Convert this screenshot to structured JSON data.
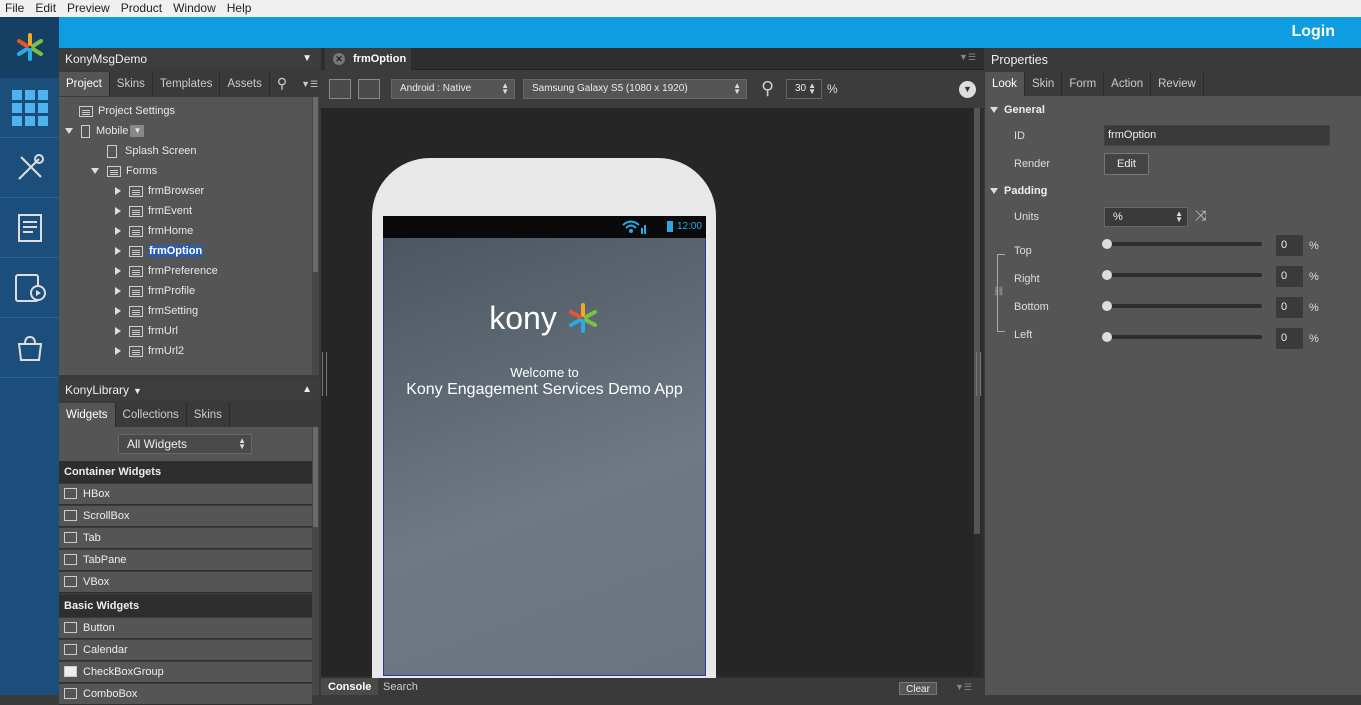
{
  "menu": [
    "File",
    "Edit",
    "Preview",
    "Product",
    "Window",
    "Help"
  ],
  "topbar": {
    "login_label": "Login"
  },
  "rail_icons": [
    "kony-logo-icon",
    "apps-grid-icon",
    "tools-icon",
    "notes-icon",
    "preview-icon",
    "store-bag-icon"
  ],
  "project": {
    "title": "KonyMsgDemo",
    "tabs": [
      "Project",
      "Skins",
      "Templates",
      "Assets"
    ],
    "tree": {
      "project_settings": "Project Settings",
      "mobile": "Mobile",
      "splash": "Splash Screen",
      "forms_label": "Forms",
      "forms": [
        "frmBrowser",
        "frmEvent",
        "frmHome",
        "frmOption",
        "frmPreference",
        "frmProfile",
        "frmSetting",
        "frmUrl",
        "frmUrl2"
      ],
      "selected": "frmOption"
    }
  },
  "library": {
    "title": "KonyLibrary",
    "tabs": [
      "Widgets",
      "Collections",
      "Skins"
    ],
    "filter": "All Widgets",
    "sections": {
      "container": "Container Widgets",
      "container_items": [
        "HBox",
        "ScrollBox",
        "Tab",
        "TabPane",
        "VBox"
      ],
      "basic": "Basic Widgets",
      "basic_items": [
        "Button",
        "Calendar",
        "CheckBoxGroup",
        "ComboBox"
      ]
    }
  },
  "editor": {
    "tab": "frmOption",
    "platform": "Android : Native",
    "device": "Samsung Galaxy S5 (1080 x 1920)",
    "zoom": "30",
    "zoom_unit": "%"
  },
  "preview": {
    "time": "12:00",
    "brand": "kony",
    "welcome": "Welcome to",
    "app_name": "Kony Engagement Services Demo App"
  },
  "bottom": {
    "tabs": [
      "Console",
      "Search"
    ],
    "clear_label": "Clear"
  },
  "properties": {
    "title": "Properties",
    "tabs": [
      "Look",
      "Skin",
      "Form",
      "Action",
      "Review"
    ],
    "general": "General",
    "id_label": "ID",
    "id_value": "frmOption",
    "render_label": "Render",
    "edit_label": "Edit",
    "padding": "Padding",
    "units_label": "Units",
    "units_value": "%",
    "sides": [
      {
        "label": "Top",
        "value": "0"
      },
      {
        "label": "Right",
        "value": "0"
      },
      {
        "label": "Bottom",
        "value": "0"
      },
      {
        "label": "Left",
        "value": "0"
      }
    ],
    "pct": "%"
  },
  "colors": {
    "accent": "#0d9de0",
    "rail": "#1b4e7a",
    "selection": "#2a5db0"
  }
}
